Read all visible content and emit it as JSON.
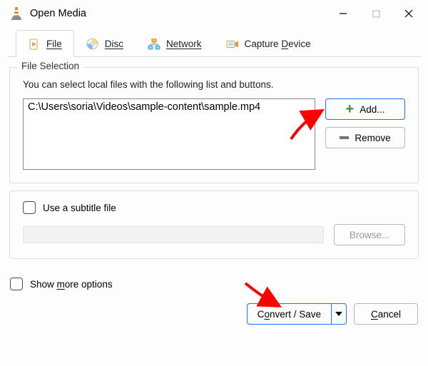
{
  "window": {
    "title": "Open Media"
  },
  "tabs": {
    "file": "File",
    "disc": "Disc",
    "network": "Network",
    "capture": "Capture Device"
  },
  "file_selection": {
    "legend": "File Selection",
    "help": "You can select local files with the following list and buttons.",
    "files": [
      "C:\\Users\\soria\\Videos\\sample-content\\sample.mp4"
    ],
    "add_label": "Add...",
    "remove_label": "Remove"
  },
  "subtitle": {
    "use_label": "Use a subtitle file",
    "browse_label": "Browse..."
  },
  "footer": {
    "more_options": "Show more options",
    "convert_save": "Convert / Save",
    "cancel": "Cancel"
  }
}
